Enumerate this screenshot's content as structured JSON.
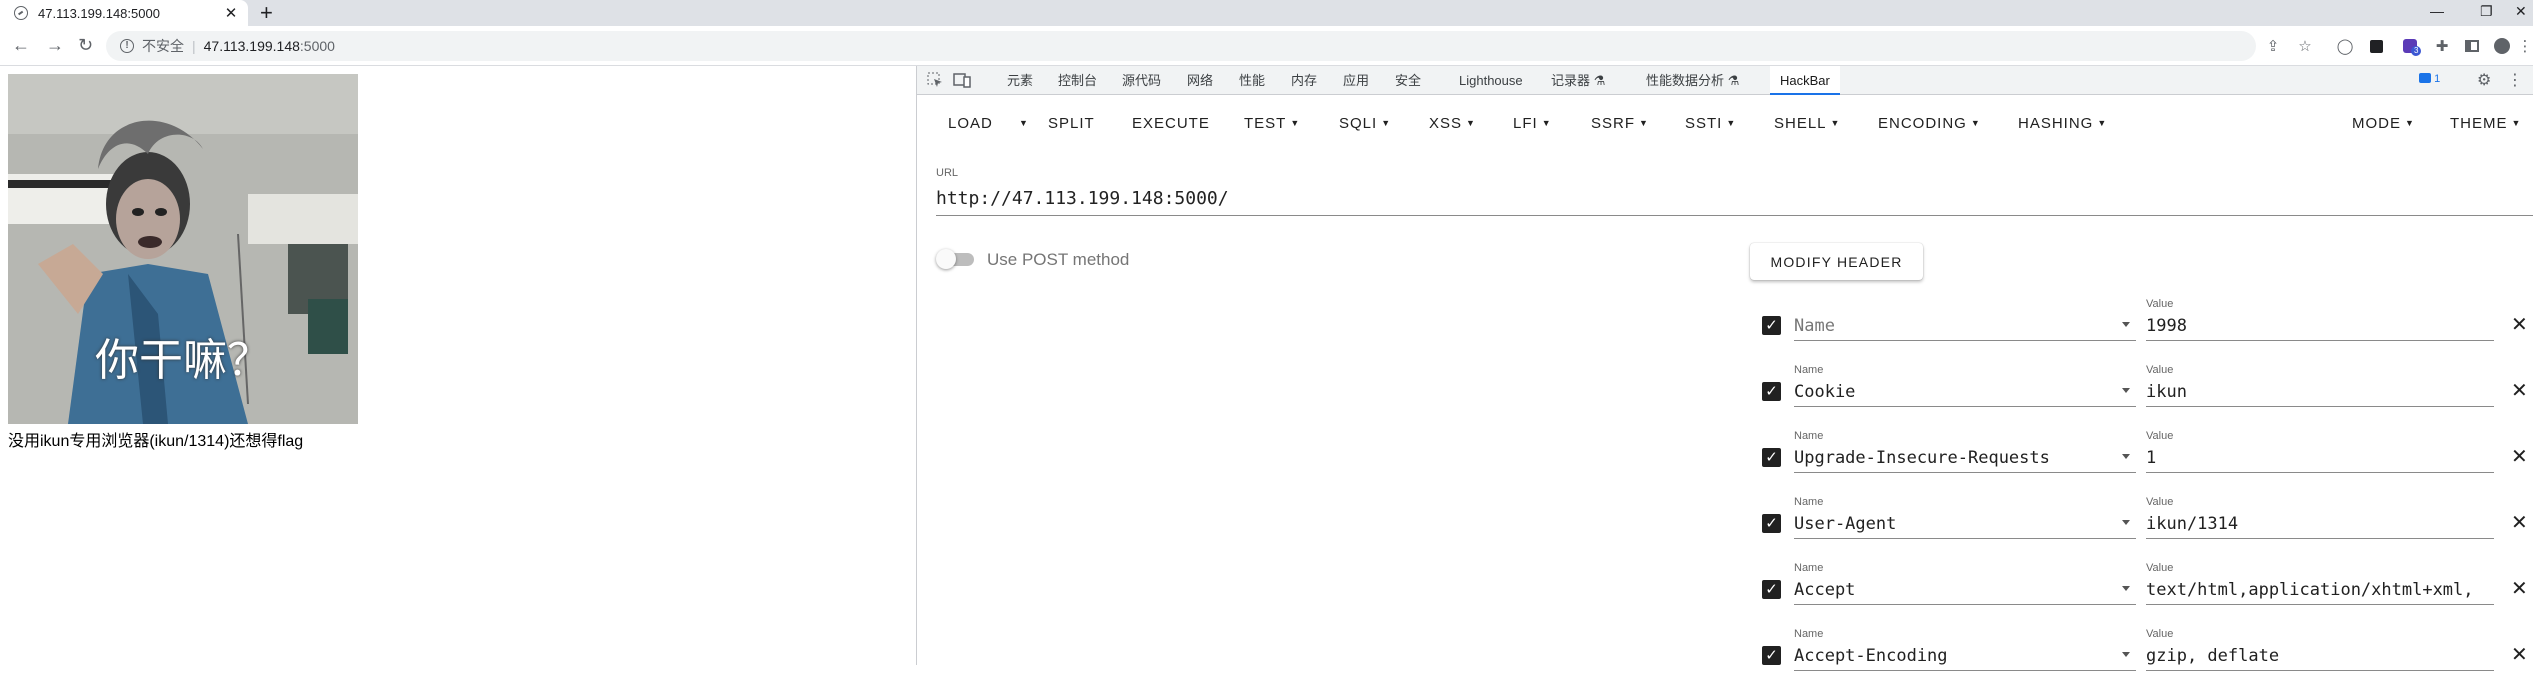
{
  "browser": {
    "tab_title": "47.113.199.148:5000",
    "tab_close": "✕",
    "new_tab": "+",
    "insecure_label": "不安全",
    "separator": "|",
    "url_host": "47.113.199.148",
    "url_port": ":5000",
    "extension_badge": "3"
  },
  "page": {
    "meme_text": "你干嘛？",
    "caption": "没用ikun专用浏览器(ikun/1314)还想得flag"
  },
  "devtools": {
    "tabs": [
      "元素",
      "控制台",
      "源代码",
      "网络",
      "性能",
      "内存",
      "应用",
      "安全",
      "Lighthouse",
      "记录器 ⚗",
      "性能数据分析 ⚗",
      "HackBar"
    ],
    "active_tab": "HackBar",
    "issues_count": "1"
  },
  "hackbar": {
    "menu": [
      {
        "label": "LOAD",
        "dropdown": false
      },
      {
        "label": "SPLIT",
        "dropdown": false
      },
      {
        "label": "EXECUTE",
        "dropdown": false
      },
      {
        "label": "TEST",
        "dropdown": true
      },
      {
        "label": "SQLI",
        "dropdown": true
      },
      {
        "label": "XSS",
        "dropdown": true
      },
      {
        "label": "LFI",
        "dropdown": true
      },
      {
        "label": "SSRF",
        "dropdown": true
      },
      {
        "label": "SSTI",
        "dropdown": true
      },
      {
        "label": "SHELL",
        "dropdown": true
      },
      {
        "label": "ENCODING",
        "dropdown": true
      },
      {
        "label": "HASHING",
        "dropdown": true
      },
      {
        "label": "MODE",
        "dropdown": true
      },
      {
        "label": "THEME",
        "dropdown": true
      }
    ],
    "url_label": "URL",
    "url_value": "http://47.113.199.148:5000/",
    "post_label": "Use POST method",
    "post_enabled": false,
    "modify_header_label": "MODIFY HEADER",
    "headers": [
      {
        "checked": true,
        "name_label": "",
        "name": "Name",
        "name_is_placeholder": true,
        "value_label": "Value",
        "value": "1998"
      },
      {
        "checked": true,
        "name_label": "Name",
        "name": "Cookie",
        "name_is_placeholder": false,
        "value_label": "Value",
        "value": "ikun"
      },
      {
        "checked": true,
        "name_label": "Name",
        "name": "Upgrade-Insecure-Requests",
        "name_is_placeholder": false,
        "value_label": "Value",
        "value": "1"
      },
      {
        "checked": true,
        "name_label": "Name",
        "name": "User-Agent",
        "name_is_placeholder": false,
        "value_label": "Value",
        "value": "ikun/1314"
      },
      {
        "checked": true,
        "name_label": "Name",
        "name": "Accept",
        "name_is_placeholder": false,
        "value_label": "Value",
        "value": "text/html,application/xhtml+xml,"
      },
      {
        "checked": true,
        "name_label": "Name",
        "name": "Accept-Encoding",
        "name_is_placeholder": false,
        "value_label": "Value",
        "value": "gzip, deflate"
      }
    ]
  }
}
